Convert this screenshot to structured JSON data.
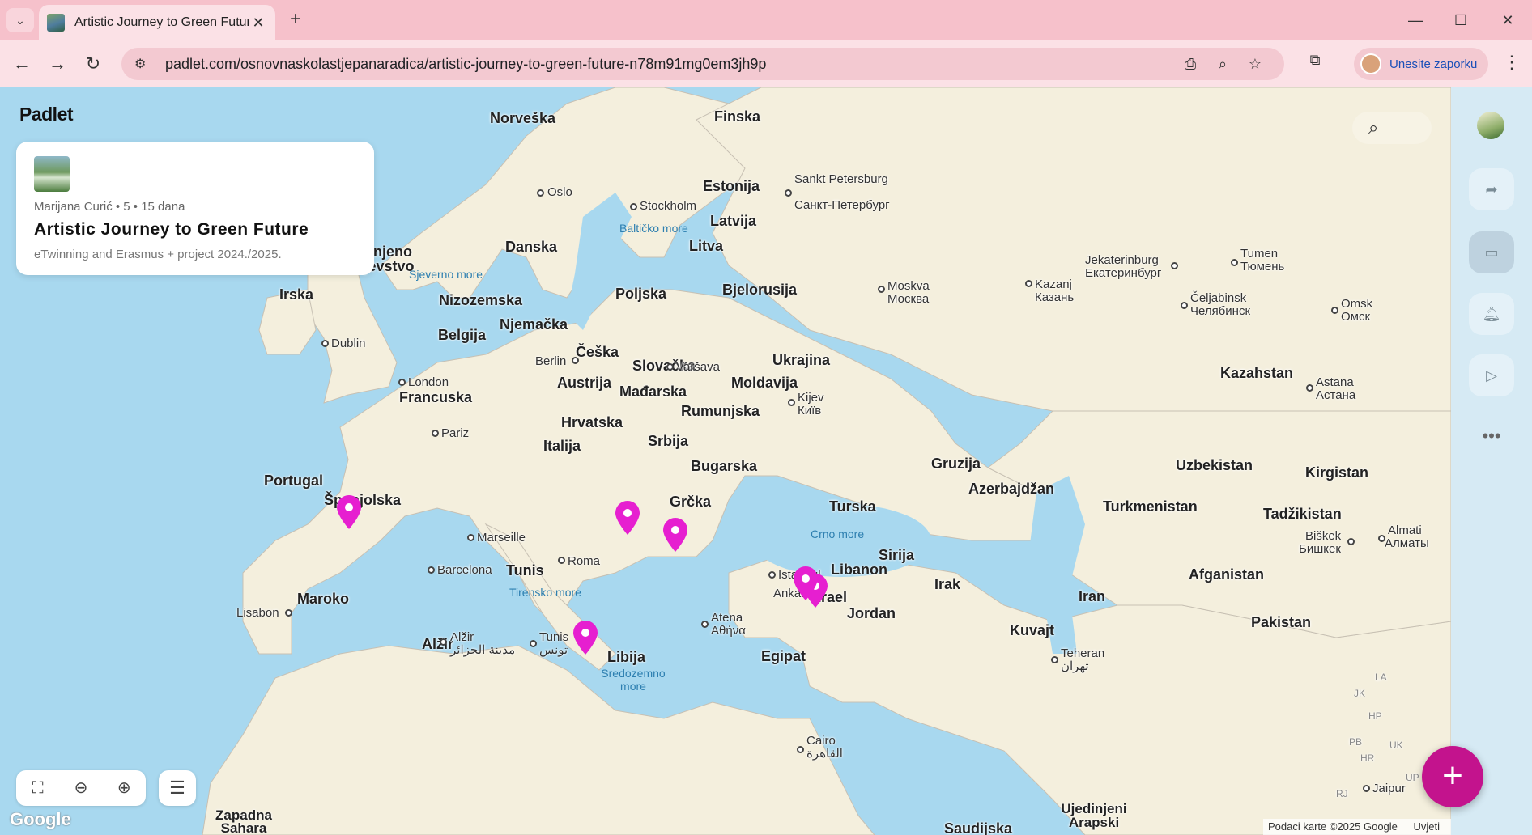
{
  "browser": {
    "tab_title": "Artistic Journey to Green Future",
    "new_tab": "+",
    "tab_close": "✕",
    "url": "padlet.com/osnovnaskolastjepanaradica/artistic-journey-to-green-future-n78m91mg0em3jh9p",
    "profile_label": "Unesite zaporku",
    "icons": [
      "tab-list-icon",
      "back-arrow-icon",
      "forward-arrow-icon",
      "reload-icon",
      "site-info-icon",
      "install-app-icon",
      "zoom-icon",
      "star-icon",
      "extensions-icon",
      "menu-dots-icon"
    ]
  },
  "padlet": {
    "brand": "Padlet",
    "card": {
      "meta": "Marijana Curić • 5 • 15 dana",
      "title": "Artistic Journey to Green Future",
      "description": "eTwinning and Erasmus + project 2024./2025."
    },
    "fab_label": "+"
  },
  "map": {
    "google_logo": "Google",
    "attribution": "Podaci karte ©2025 Google",
    "terms": "Uvjeti",
    "pin_color": "#e61fd0",
    "countries": [
      "Norveška",
      "Finska",
      "Estonija",
      "Latvija",
      "Litva",
      "Danska",
      "Ujedinjeno Kraljevstvo",
      "Irska",
      "Nizozemska",
      "Belgija",
      "Njemačka",
      "Poljska",
      "Bjelorusija",
      "Češka",
      "Slovačka",
      "Ukrajina",
      "Austrija",
      "Moldavija",
      "Mađarska",
      "Rumunjska",
      "Francuska",
      "Hrvatska",
      "Srbija",
      "Italija",
      "Bugarska",
      "Portugal",
      "Španjolska",
      "Grčka",
      "Turska",
      "Gruzija",
      "Azerbajdžan",
      "Kazahstan",
      "Uzbekistan",
      "Kirgistan",
      "Turkmenistan",
      "Tadžikistan",
      "Sirija",
      "Libanon",
      "Irak",
      "Iran",
      "Afganistan",
      "Izrael",
      "Jordan",
      "Kuvajt",
      "Pakistan",
      "Maroko",
      "Alžir",
      "Tunis",
      "Libija",
      "Egipat",
      "Zapadna Sahara",
      "Saudijska",
      "Ujedinjeni Arapski"
    ],
    "cities": [
      "Oslo",
      "Stockholm",
      "Sankt Petersburg",
      "Санкт-Петербург",
      "Dublin",
      "London",
      "Berlin",
      "Varšava",
      "Moskva",
      "Москва",
      "Kijev",
      "Київ",
      "Pariz",
      "Marseille",
      "Roma",
      "Barcelona",
      "Lisabon",
      "Alžir",
      "مدينة الجزائر",
      "Tunis",
      "تونس",
      "Atena",
      "Αθήνα",
      "Istanbul",
      "Ankara",
      "Cairo",
      "القاهرة",
      "Teheran",
      "تهران",
      "Jekaterinburg",
      "Екатеринбург",
      "Tumen",
      "Тюмень",
      "Kazanj",
      "Казань",
      "Čeljabinsk",
      "Челябинск",
      "Omsk",
      "Омск",
      "Astana",
      "Астана",
      "Biškek",
      "Бишкек",
      "Almati",
      "Алматы",
      "Jaipur",
      "LA",
      "JK",
      "HP",
      "PB",
      "HR",
      "UK",
      "RJ",
      "UP"
    ],
    "seas": [
      "Sjeverno more",
      "Baltičko more",
      "Crno more",
      "Tirensko more",
      "Sredozemno more"
    ]
  },
  "sidebar": {
    "icons": [
      "share-icon",
      "slideshow-icon",
      "bell-icon",
      "play-icon"
    ],
    "more": "•••"
  }
}
